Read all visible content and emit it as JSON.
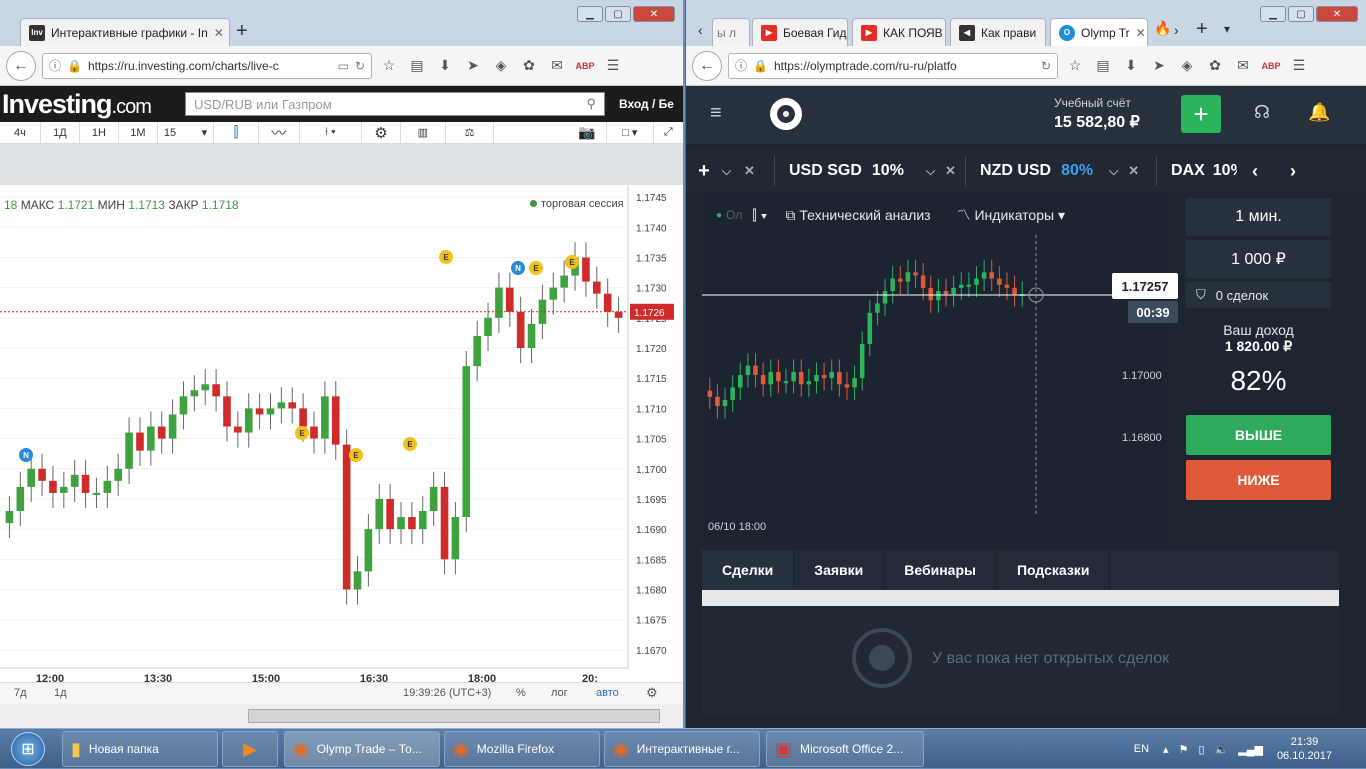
{
  "left_browser": {
    "tab_title": "Интерактивные графики - In",
    "url": "https://ru.investing.com/charts/live-c",
    "logo_main": "Investing",
    "logo_suffix": ".com",
    "search_placeholder": "USD/RUB или Газпром",
    "login": "Вход / Бе",
    "timeframes": [
      "4ч",
      "1Д",
      "1Н",
      "1М",
      "15"
    ],
    "ohlc": {
      "prefix": "18",
      "max_label": "МАКС",
      "max": "1.1721",
      "min_label": "МИН",
      "min": "1.1713",
      "close_label": "ЗАКР",
      "close": "1.1718"
    },
    "session_label": "торговая сессия",
    "bottom": {
      "range1": "7д",
      "range2": "1д",
      "clock": "19:39:26 (UTC+3)",
      "pct": "%",
      "log": "лог",
      "auto": "авто"
    }
  },
  "right_browser": {
    "tabs": [
      "ы л",
      "Боевая Гид",
      "КАК ПОЯВ",
      "Как прави",
      "Olymp Tr"
    ],
    "url": "https://olymptrade.com/ru-ru/platfo",
    "account_label": "Учебный счёт",
    "balance": "15 582,80 ₽",
    "assets": [
      {
        "name": "USD SGD",
        "pct": "10%"
      },
      {
        "name": "NZD USD",
        "pct": "80%"
      },
      {
        "name": "DAX",
        "pct": "10%"
      }
    ],
    "chart_tools": {
      "analysis": "Технический анализ",
      "indicators": "Индикаторы",
      "ol": "Ол"
    },
    "price_tag": "1.17257",
    "timer": "00:39",
    "date_label": "06/10 18:00",
    "sidebar": {
      "duration": "1 мин.",
      "amount": "1 000 ₽",
      "deals": "0 сделок",
      "income_label": "Ваш доход",
      "income": "1 820.00 ₽",
      "payout": "82%",
      "up": "ВЫШЕ",
      "down": "НИЖЕ"
    },
    "bottom_tabs": [
      "Сделки",
      "Заявки",
      "Вебинары",
      "Подсказки"
    ],
    "empty_text": "У вас пока нет открытых сделок"
  },
  "taskbar": {
    "items": [
      "Новая папка",
      "Olymp Trade – То...",
      "Mozilla Firefox",
      "Интерактивные г...",
      "Microsoft Office 2..."
    ],
    "lang": "EN",
    "time": "21:39",
    "date": "06.10.2017"
  },
  "chart_data": [
    {
      "type": "candlestick",
      "source": "investing",
      "x_ticks": [
        "12:00",
        "13:30",
        "15:00",
        "16:30",
        "18:00",
        "20:"
      ],
      "y_ticks": [
        "1.1745",
        "1.1740",
        "1.1735",
        "1.1730",
        "1.1725",
        "1.1720",
        "1.1715",
        "1.1710",
        "1.1705",
        "1.1700",
        "1.1695",
        "1.1690",
        "1.1685",
        "1.1680",
        "1.1675",
        "1.1670"
      ],
      "ylim": [
        1.1667,
        1.1747
      ],
      "current_price": "1.1726",
      "event_badges": [
        "N",
        "E",
        "E",
        "E",
        "E",
        "N",
        "E",
        "E"
      ],
      "close_series": [
        1.1693,
        1.1697,
        1.17,
        1.1698,
        1.1696,
        1.1697,
        1.1699,
        1.1696,
        1.1696,
        1.1698,
        1.17,
        1.1706,
        1.1703,
        1.1707,
        1.1705,
        1.1709,
        1.1712,
        1.1713,
        1.1714,
        1.1712,
        1.1707,
        1.1706,
        1.171,
        1.1709,
        1.171,
        1.1711,
        1.171,
        1.1707,
        1.1705,
        1.1712,
        1.1704,
        1.168,
        1.1683,
        1.169,
        1.1695,
        1.169,
        1.1692,
        1.169,
        1.1693,
        1.1697,
        1.1685,
        1.1692,
        1.1717,
        1.1722,
        1.1725,
        1.173,
        1.1726,
        1.172,
        1.1724,
        1.1728,
        1.173,
        1.1732,
        1.1735,
        1.1731,
        1.1729,
        1.1726,
        1.1725
      ]
    },
    {
      "type": "candlestick",
      "source": "olymptrade",
      "y_ticks": [
        "1.17000",
        "1.16800"
      ],
      "ylim": [
        1.1655,
        1.1745
      ],
      "current_price": "1.17257",
      "x_label": "06/10 18:00",
      "close_series": [
        1.1693,
        1.169,
        1.1692,
        1.1696,
        1.17,
        1.1703,
        1.17,
        1.1697,
        1.1701,
        1.1698,
        1.1698,
        1.1701,
        1.1697,
        1.1698,
        1.17,
        1.1699,
        1.1701,
        1.1697,
        1.1696,
        1.1699,
        1.171,
        1.172,
        1.1723,
        1.1727,
        1.1731,
        1.173,
        1.1733,
        1.1732,
        1.1728,
        1.1724,
        1.1727,
        1.1726,
        1.1728,
        1.1729,
        1.1729,
        1.1731,
        1.1733,
        1.1731,
        1.1729,
        1.1728,
        1.1726,
        1.1726
      ]
    }
  ]
}
